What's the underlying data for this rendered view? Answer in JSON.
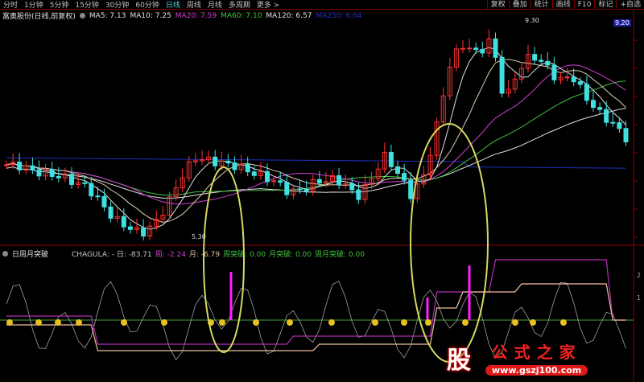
{
  "toolbar": {
    "periods": [
      "分时",
      "1分钟",
      "5分钟",
      "15分钟",
      "30分钟",
      "60分钟",
      "日线",
      "周线",
      "月线",
      "多周期",
      "更多 >"
    ],
    "active": "日线",
    "buttons": [
      "复权",
      "叠加",
      "统计",
      "画线",
      "F10",
      "标记",
      "+自选"
    ]
  },
  "main_legend": {
    "title": "富奥股份(日线,前复权)",
    "ma": [
      {
        "label": "MA5: 7.13",
        "color": "#e0e0e0"
      },
      {
        "label": "MA10: 7.25",
        "color": "#e0e0e0"
      },
      {
        "label": "MA20: 7.59",
        "color": "#d040d0"
      },
      {
        "label": "MA60: 7.10",
        "color": "#40c040"
      },
      {
        "label": "MA120: 6.57",
        "color": "#e0e0e0"
      },
      {
        "label": "MA250: 6.64",
        "color": "#2030c0"
      }
    ]
  },
  "price_axis": {
    "top_label": "9.20"
  },
  "annotations": {
    "high": "9.30",
    "low": "5.30"
  },
  "indicator_legend": {
    "title": "日周月突破",
    "items": [
      {
        "label": "CHAGULA: - 日: -83.71",
        "color": "#c8c8c8"
      },
      {
        "label": "周: -2.24",
        "color": "#d040d0"
      },
      {
        "label": "月: -6.79",
        "color": "#e0c0a0"
      },
      {
        "label": "周突破: 0.00",
        "color": "#40c040"
      },
      {
        "label": "月突破: 0.00",
        "color": "#40c040"
      },
      {
        "label": "周月突破: 0.00",
        "color": "#40c040"
      }
    ]
  },
  "indicator_axis": [
    "2",
    "1"
  ],
  "watermark": {
    "logo": "股",
    "name": "公式之家",
    "url": "www.gszj100.com"
  },
  "chart_data": {
    "type": "candlestick",
    "price_range": [
      5.3,
      9.3
    ],
    "close_keypoints": [
      6.62,
      6.6,
      6.5,
      6.45,
      6.4,
      6.3,
      6.2,
      5.9,
      5.6,
      5.45,
      5.32,
      5.5,
      5.9,
      6.4,
      6.75,
      6.7,
      6.65,
      6.6,
      6.5,
      6.4,
      6.3,
      6.1,
      6.15,
      6.3,
      6.35,
      6.3,
      6.0,
      6.3,
      6.8,
      6.5,
      6.05,
      6.4,
      7.4,
      8.6,
      8.9,
      8.7,
      9.0,
      7.8,
      8.4,
      8.7,
      8.5,
      8.2,
      8.3,
      7.9,
      7.6,
      7.4,
      7.13
    ],
    "colors": {
      "up": "#ff3030",
      "down": "#40e0e0"
    }
  }
}
